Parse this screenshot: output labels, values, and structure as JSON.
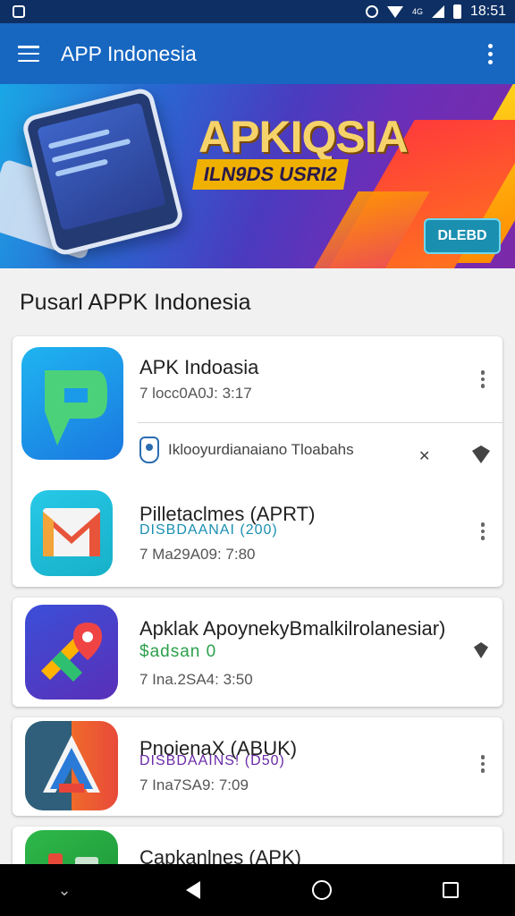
{
  "status_bar": {
    "time": "18:51",
    "net_label": "4G"
  },
  "app_bar": {
    "title": "APP Indonesia"
  },
  "banner": {
    "headline": "APKIQSIA",
    "tagline": "ILN9DS USRI2",
    "cta_label": "DLEBD"
  },
  "section": {
    "title": "Pusarl APPK Indonesia"
  },
  "apps": [
    {
      "name": "APK Indoasia",
      "meta": "7 locc0A0J: 3:17",
      "publisher": "Iklooyurdianaiano Tloabahs",
      "icon": "p-logo-icon"
    },
    {
      "name": "Pilletaclmes (APRT)",
      "sub": "DISBDAANAI (200)",
      "sub_color": "#1a8fb0",
      "meta": "7 Ma29A09: 7:80",
      "icon": "mail-m-icon"
    },
    {
      "name": "Apklak ApoynekyBmalkilrolanesiar)",
      "sub": "$adsan 0",
      "sub_color": "#2aa04a",
      "meta": "7 Ina.2SA4: 3:50",
      "icon": "maps-pin-icon"
    },
    {
      "name": "PnoienaX (ABUK)",
      "sub": "DISBDAAINS! (D50)",
      "sub_color": "#6a2aa8",
      "meta": "7 Ina7SA9: 7:09",
      "icon": "a-logo-icon"
    },
    {
      "name": "Capkanlnes (APK)",
      "icon": "green-app-icon"
    }
  ]
}
